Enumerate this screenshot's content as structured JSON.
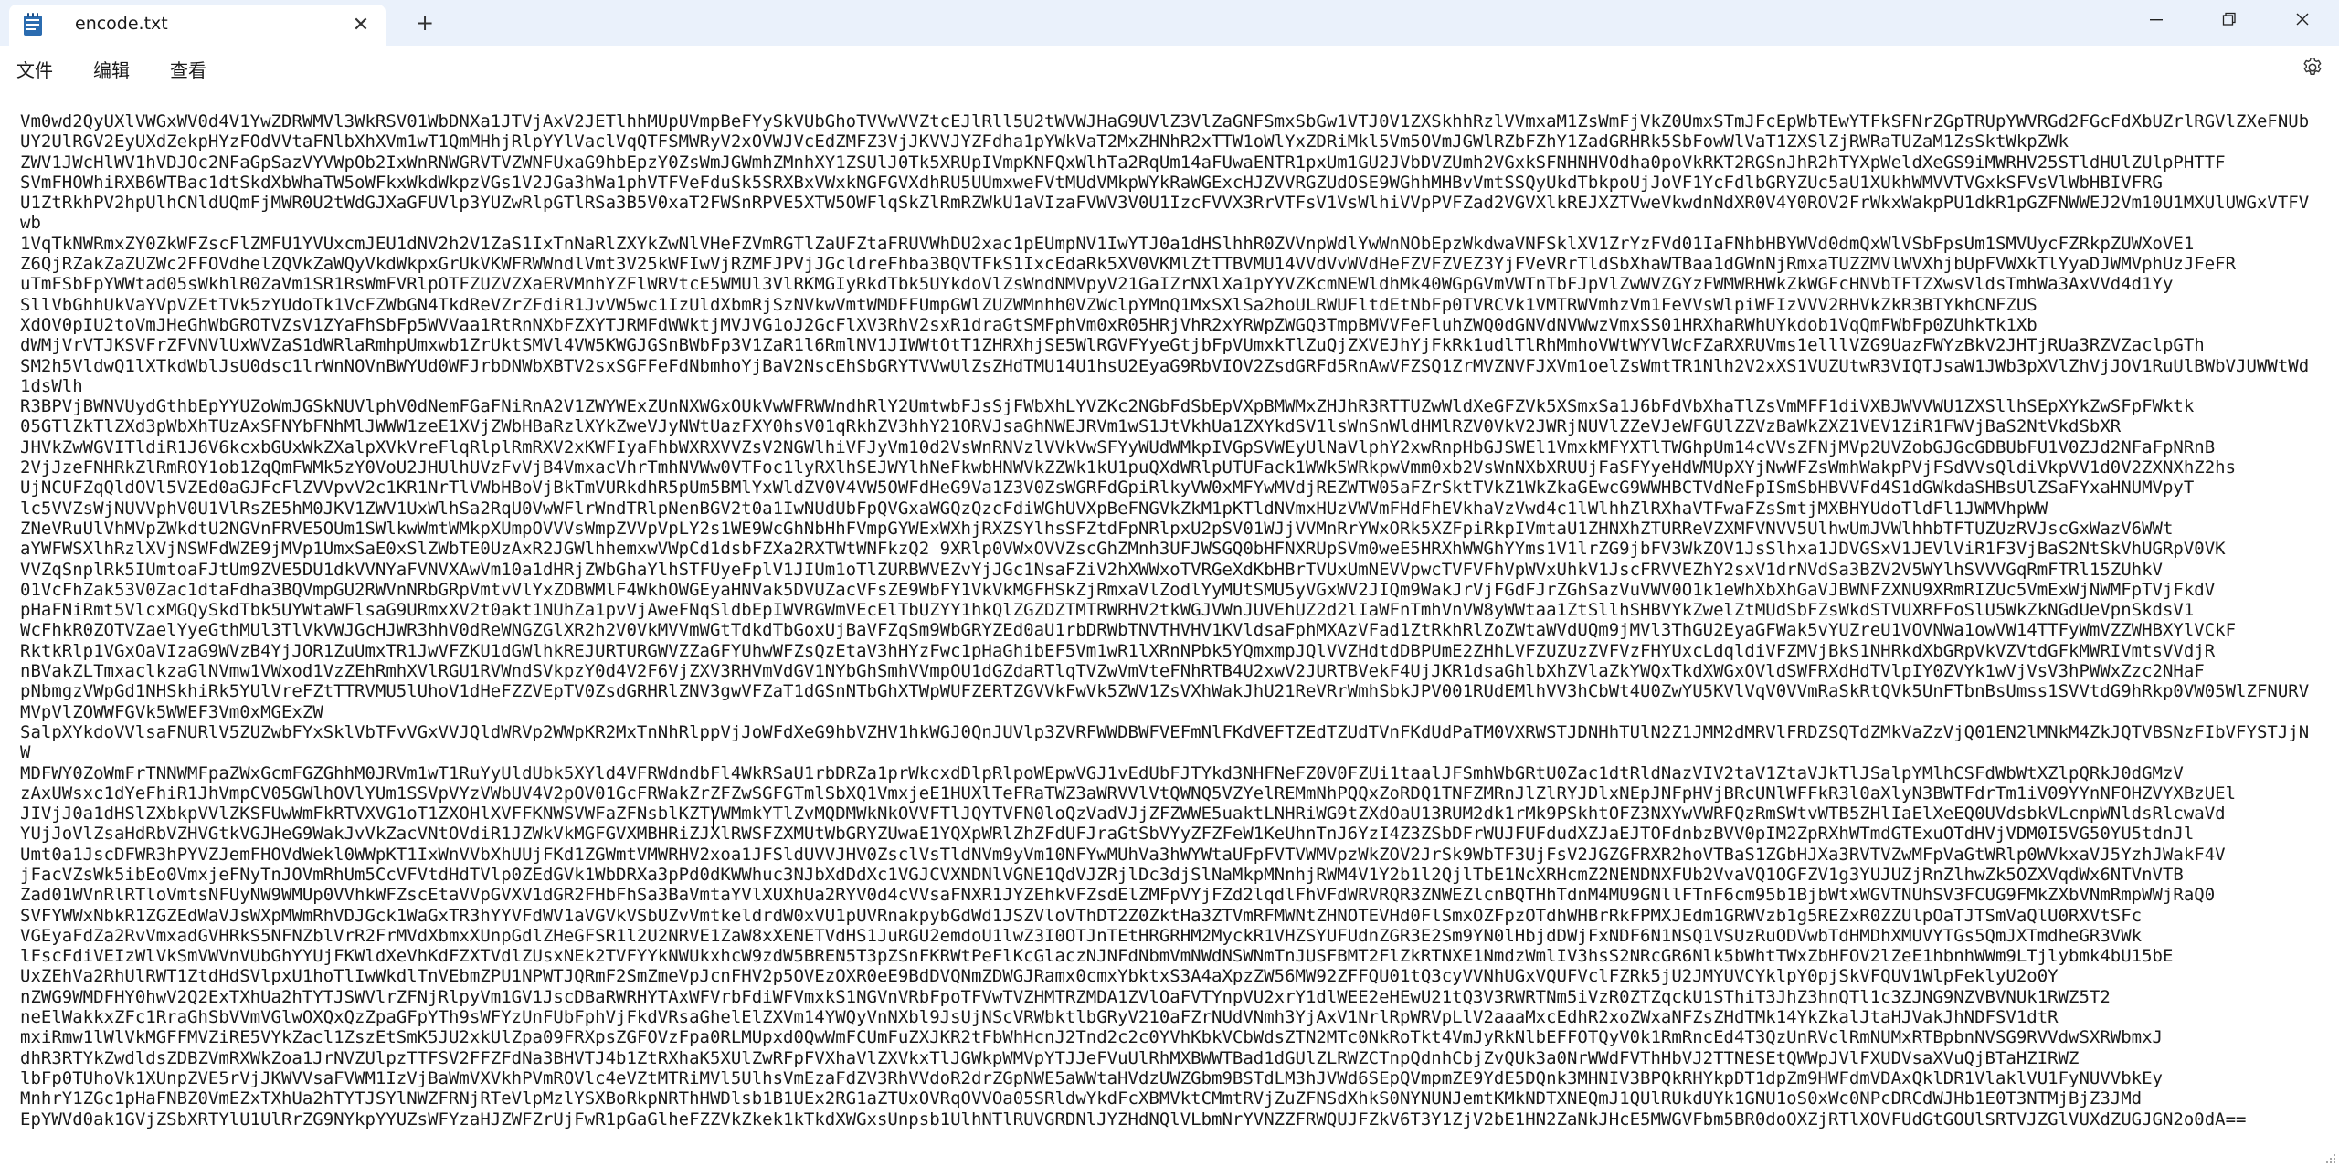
{
  "window": {
    "tab_title": "encode.txt",
    "tab_close_glyph": "✕",
    "new_tab_glyph": "+",
    "icons": {
      "app": "notepad-icon",
      "minimize": "minimize-icon",
      "maximize": "maximize-icon",
      "close": "close-icon",
      "settings": "gear-icon"
    }
  },
  "menu": {
    "file": "文件",
    "edit": "编辑",
    "view": "查看"
  },
  "colors": {
    "titlebar": "#eaf1fb",
    "tab": "#ffffff",
    "text": "#1a1a1a",
    "icon_blue": "#2b6cb0"
  },
  "editor": {
    "content": "Vm0wd2QyUXlVWGxWV0d4V1YwZDRWMVl3WkRSV01WbDNXa1JTVjAxV2JETlhhMUpUVmpBeFYySkVUbGhoTVVwVVZtcEJlRll5U2tWVWJHaG9UVlZ3VlZaGNFSmxSbGw1VTJ0V1ZXSkhhRzlVVmxaM1ZsWmFjVkZ0UmxSTmJFcEpWbTEwYTFkSFNrZGpTRUpYWVRGd2FGcFdXbUZrlRGVlZXeFNUbUY2UlRGV2EyUXdZekpHYzFOdVVtaFNlbXhXVm1wT1QmMHhjRlpYYlVaclVqQTFSMWRyV2xOVWJVcEdZMFZ3VjJKVVJYZFdha1pYWkVaT2MxZHNhR2xTTW1oWlYxZDRiMkl5Vm5OVmJGWlRZbFZhY1ZadGRHRk5SbFowWlVaT1ZXSlZjRWRaTUZaM1ZsSktWkpZWk\nZWV1JWcHlWV1hVDJOc2NFaGpSazVYVWpOb2IxWnRNWGRVTVZWNFUxaG9hbEpzY0ZsWmJGWmhZMnhXY1ZSUlJ0Tk5XRUpIVmpKNFQxWlhTa2RqUm14aFUwaENTR1pxUm1GU2JVbDVZUmh2VGxkSFNHNHVOdha0poVkRKT2RGSnJhR2hTYXpWeldXeGS9iMWRHV25STldHUlZUlpPHTTF\nSVmFHOWhiRXB6WTBac1dtSkdXbWhaTW5oWFkxWkdWkpzVGs1V2JGa3hWa1phVTFVeFduSk5SRXBxVWxkNGFGVXdhRU5UUmxweFVtMUdVMkpWYkRaWGExcHJZVVRGZUdOSE9WGhhMHBvVmtSSQyUkdTbkpoUjJoVF1YcFdlbGRYZUc5aU1XUkhWMVVTVGxkSFVsVlWbHBIVFRG\nU1ZtRkhPV2hpUlhCNldUQmFjMWR0U2tWdGJXaGFUVlp3YUZwRlpGTlRSa3B5V0xaT2FWSnRPVE5XTW5OWFlqSkZlRmRZWkU1aVIzaFVWV3V0U1IzcFVVX3RrVTFsV1VsWlhiVVpPVFZad2VGVXlkREJXZTVweVkwdnNdXR0V4Y0ROV2FrWkxWakpPU1dkR1pGZFNWWEJ2Vm10U1MXUlUWGxVTFVwb\n1VqTkNWRmxZY0ZkWFZscFlZMFU1YVUxcmJEU1dNV2h2V1ZaS1IxTnNaRlZXYkZwNlVHeFZVmRGTlZaUFZtaFRUVWhDU2xac1pEUmpNV1IwYTJ0a1dHSlhhR0ZVVnpWdlYwWnNObEpzWkdwaVNFSklXV1ZrYzFVd01IaFNhbHBYWVd0dmQxWlVSbFpsUm1SMVUycFZRkpZUWXoVE1\nZ6QjRZakZaZUZWc2FFOVdhelZQVkZaWQyVkdWkpxGrUkVKWFRWWndlVmt3V25kWFIwVjRZMFJPVjJGcldreFhba3BQVTFkS1IxcEdaRk5XV0VKMlZtTTBVMU14VVdVvWVdHeFZVFZVEZ3YjFVeVRrTldSbXhaWTBaa1dGWnNjRmxaTUZZMVlWVXhjbUpFVWXkTlYyaDJWMVphUzJFeFR\nuTmFSbFpYWWtad05sWkhlR0ZaVm1SR1RsWmFVRlpOTFZUZVZXaERVMnhYZFlWRVtcE5WMUl3VlRKMGIyRkdTbk5UYkdoVlZsWndNMVpyV21GaIZrNXlXa1pYYVZKcmNEWldhMk40WGpGVmVWTnTbFJpVlZwWVZGYzFWMWRHWkZkWGFcHNVbTFTZXwsVldsTmhWa3AxVVd4d1Yy\nSllVbGhhUkVaYVpVZEtTVk5zYUdoTk1VcFZWbGN4TkdReVZrZFdiR1JvVW5wc1IzUldXbmRjSzNVkwVmtWMDFFUmpGWlZUZWMnhh0VZWclpYMnQ1MxSXlSa2hoULRWUFltdEtNbFp0TVRCVk1VMTRWVmhzVm1FeVVsWlpiWFIzVVV2RHVkZkR3BTYkhCNFZUS\nXdOV0pIU2toVmJHeGhWbGROTVZsV1ZYaFhSbFp5WVVaa1RtRnNXbFZXYTJRMFdWWktjMVJVG1oJ2GcFlXV3RhV2sxR1draGtSMFphVm0xR05HRjVhR2xYRWpZWGQ3TmpBMVVFeFluhZWQ0dGNVdNVWwzVmxSS01HRXhaRWhUYkdob1VqQmFWbFp0ZUhkTk1Xb\ndWMjVrVTJKSVFrZFVNVlUxWVZaS1dWRlaRmhpUmxwb1ZrUktSMVl4VW5KWGJGSnBWbFp3V1ZaR1l6RmlNV1JIWWtOtT1ZHRXhjSE5WlRGVFYyeGtjbFpVUmxkTlZuQjZXVEJhYjFkRk1udlTlRhMmhoVWtWYVlWcFZaRXRUVms1elllVZG9UazFWYzBkV2JHTjRUa3RZVZaclpGTh\nSM2h5VldwQ1lXTkdWblJsU0dsc1lrWnNOVnBWYUd0WFJrbDNWbXBTV2sxSGFFeFdNbmhoYjBaV2NscEhSbGRYTVVwUlZsZHdTMU14U1hsU2EyaG9RbVIOV2ZsdGRFd5RnAwVFZSQ1ZrMVZNVFJXVm1oelZsWmtTR1Nlh2V2xXS1VUZUtwR3VIQTJsaW1JWb3pXVlZhVjJOV1RuUlBWbVJUWWtWd1dsWlh\nR3BPVjBWNVUydGthbEpYYUZoWmJGSkNUVlphV0dNemFGaFNiRnA2V1ZWYWExZUnNXWGxOUkVwWFRWWndhRlY2UmtwbFJsSjFWbXhLYVZKc2NGbFdSbEpVXpBMWMxZHJhR3RTTUZwWldXeGFZVk5XSmxSa1J6bFdVbXhaTlZsVmMFF1diVXBJWVVWU1ZXSllhSEpXYkZwSFpFWktk\n05GTlZkTlZXd3pWbXhTUzAxSFNYbFNhMlJWWW1zeE1XVjZWbHBaRzlXYkZweVJyNWtUazFXY0hsV01qRkhZV3hhY21ORVJsaGhNWEJRVm1wS1JtVkhUa1ZXYkdSV1lsWnSnWldHMlRZV0VkV2JWRjNUVlZZeVJeWFGUlZZVzBaWkZXZ1VEV1ZiR1FWVjBaS2NtVkdSbXR\nJHVkZwWGVITldiR1J6V6kcxbGUxWkZXalpXVkVreFlqRlplRmRXV2xKWFIyaFhbWXRXVVZsV2NGWlhiVFJyVm10d2VsWnRNVzlVVkVwSFYyWUdWMkpIVGpSVWEyUlNaVlphY2xwRnpHbGJSWEl1VmxkMFYXTlTWGhpUm14cVVsZFNjMVp2UVZobGJGcGDBUbFU1V0ZJd2NFaFpNRnB\n2VjJzeFNHRkZlRmROY1ob1ZqQmFWMk5zY0VoU2JHUlhUVzFvVjB4VmxacVhrTmhNVWw0VTFoc1lyRXlhSEJWYlhNeFkwbHNWVkZZWk1kU1puQXdWRlpUTUFack1WWk5WRkpwVmm0xb2VsWnNXbXRUUjFaSFYyeHdWMUpXYjNwWFZsWmhWakpPVjFSdVVsQldiVkpVV1d0V2ZXNXhZ2hs\nUjNCUFZqQldOVl5VZEd0aGJFcFlZVVpvV2c1KR1NrTlVWbHBoVjBkTmVURkdhR5pUm5BMlYxWldZV0V4VW5OWFdHeG9Va1Z3V0ZsWGRFdGpiRlkyVW0xMFYwMVdjREZWTW05aFZrSktTVkZ1WkZkaGEwcG9WWHBCTVdNeFpISmSbHBVVFd4S1dGWkdaSHBsUlZSaFYxaHNUMVpyT\nlc5VVZsWjNUVVphV0U1VlRsZE5hM0JKV1ZWV1UxWlhSa2RqU0VwWFlrWndTRlpNenBGV2t0a1IwNUdUbFpQVGxaWGQzQzcFdiWGhUVXpBeFNGVkZkM1pKTldNVmxHUzVWVmFHdFhEVkhaVzVwd4c1lWlhhZlRXhaVTFwaFZsSmtjMXBHYUdoTldFl1JWMVhpWW\nZNeVRuUlVhMVpZWkdtU2NGVnFRVE5OUm1SWlkwWmtWMkpXUmpOVVVsWmpZVVpVpLY2s1WE9WcGhNbHhFVmpGYWExWXhjRXZSYlhsSFZtdFpNRlpxU2pSV01WJjVVMnRrYWxORk5XZFpiRkpIVmtaU1ZHNXhZTURReVZXMFVNVV5UlhwUmJVWlhhbTFTUZUzRVJscGxWazV6WWt\naYWFWSXlhRzlXVjNSWFdWZE9jMVp1UmxSaE0xSlZWbTE0UzAxR2JGWlhhemxwVWpCd1dsbFZXa2RXTWtWNFkzQ2 9XRlp0VWxOVVZscGhZMnh3UFJWSGQ0bHFNXRUpSVm0weE5HRXhWWGhYYms1V1lrZG9jbFV3WkZOV1JsSlhxa1JDVGSxV1JEVlViR1F3VjBaS2NtSkVhUGRpV0VK\nVVZqSnplRk5IUmtoaFJtUm9ZVE5DU1dkVVNYaFVNVXAwVm10a1dHRjZWbGhaYlhSTFUyeFplV1JIUm1oTlZURBWVEZvYjJGc1NsaFZiV2hXWWxoTVRGeXdKbHBrTVUxUmNEVVpwcTVFVFhVpWVxUhkV1JscFRVVEZhY2sxV1drNVdSa3BZV2V5WYlhSVVVGqRmFTRl15ZUhkV\n01VcFhZak53V0Zac1dtaFdha3BQVmpGU2RWVnNRbGRpVmtvVlYxZDBWMlF4WkhOWGEyaHNVak5DVUZacVFsZE9WbFY1VkVkMGFHSkZjRmxaVlZodlYyMUtSMU5yVGxWV2JIQm9WakJrVjFGdFJrZGhSazVuVWV0O1k1eWhXbXhGaVJBWNFZXNU9XRmRIZUc5VmExWjNWMFpTVjFkdV\npHaFNiRmt5VlcxMGQySkdTbk5UYWtaWFlsaG9URmxXV2t0akt1NUhZa1pvVjAweFNqSldbEpIWVRGWmVEcElTbUZYY1hkQlZGZDZTMTRWRHV2tkWGJVWnJUVEhUZ2d2lIaWFnTmhVnVW8yWWtaa1ZtSllhSHBVYkZwelZtMUdSbFZsWkdSTVUXRFFoSlU5WkZkNGdUeVpnSkdsV1\nWcFhkR0ZOTVZaelYyeGthMUl3TlVkVWJGcHJWR3hhV0dReWNGZGlXR2h2V0VkMVVmWGtTdkdTbGoxUjBaVFZqSm9WbGRYZEd0aU1rbDRWbTNVTHVHV1KVldsaFphMXAzVFad1ZtRkhRlZoZWtaWVdUQm9jMVl3ThGU2EyaGFWak5vYUZreU1VOVNWa1owVW14TTFyWmVZZWHBXYlVCkF\nRktkRlp1VGxOaVIzaG9WVzB4YjJOR1ZuUmxTR1JwVFZKU1dGWlhkREJURTURGWVZZaGFYUhwWFZsQzEtaV3hHYzFwc1pHaGhibEF5Vm1wR1lXRnNPbk5YQmxmpJQlVVZHdtdDBPUmE2ZHhLVFZUZUzZVFVzFHYUxcLdqldiVFZMVjBkS1NHRkdXbGRpVkVZVtdGFkMWRIVmtsVVdjR\nnBVakZLTmxaclkzaGlNVmw1VWxod1VzZEhRmhXVlRGU1RVWndSVkpzY0d4V2F6VjZXV3RHVmVdGV1NYbGhSmhVVmpOU1dGZdaRTlqTVZwVmVteFNhRTB4U2xwV2JURTBVekF4UjJKR1dsaGhlbXhZVlaZkYWQxTkdXWGxOVldSWFRXdHdTVlpIY0ZVYk1wVjVsV3hPWWxZzc2NHaF\npNbmgzVWpGd1NHSkhiRk5YUlVreFZtTTRVMU5lUhoV1dHeFZZVEpTV0ZsdGRHRlZNV3gwVFZaT1dGSnNTbGhXTWpWUFZERTZGVVkFwVk5ZWV1ZsVXhWakJhU21ReVRrWmhSbkJPV001RUdEMlhVV3hCbWt4U0ZwYU5KVlVqV0VVmRaSkRtQVk5UnFTbnBsUmss1SVVtdG9hRkp0VW05WlZFNURVMVpVlZOWWFGVk5WWEF3Vm0xMGExZW\nSalpXYkdoVVlsaFNURlV5ZUZwbFYxSklVbTFvVGxVVJQldWRVp2WWpKR2MxTnNhRlppVjJoWFdXeG9hbVZHV1hkWGJ0QnJUVlp3ZVRFWWDBWFVEFmNlFKdVEFTZEdTZUdTVnFKdUdPaTM0VXRWSTJDNHhTUlN2Z1JMM2dMRVlFRDZSQTdZMkVaZzVjQ01EN2lMNkM4ZkJQTVBSNzFIbVFYSTJjNW\nMDFWY0ZoWmFrTNNWMFpaZWxGcmFGZGhhM0JRVm1wT1RuYyUldUbk5XYld4VFRWdndbFl4WkRSaU1rbDRZa1prWkcxdDlpRlpoWEpwVGJ1vEdUbFJTYkd3NHFNeFZ0V0FZUi1taalJFSmhWbGRtU0Zac1dtRldNazVIV2taV1ZtaVJkTlJSalpYMlhCSFdWbWtXZlpQRkJ0dGMzV\nzAxUWsxc1dYeFhiR1JhVmpCV05GWlhOVlYUm1SSVpVYzVWbUV4V2pOV01GcFRWakZrZFZwSGFGTmlSbXQ1VmxjeE1HUXlTeFRaTWZ3aWRVVlVtQWNQ5VZYelREMmNhPQQxZoRDQ1TNFZMRnJlZlRYJDlxNEpJNFpHVjBRcUNlWFFkR3l0aXlyN3BWTFdrTm1iV09YYnNFOHZVYXBzUEl\nJIVjJ0a1dHSlZXbkpVVlZKSFUwWmFkRTVXVG1oT1ZXOHlXVFFKNWSVWFaZFNsblKZTVWMmkYTlZvMQDMWkNkOVVFTlJQYTVFN0loQzVadVJjZFZWWE5uaktLNHRiWG9tZXdOaU13RUM2dk1rMk9PSkhtOFZ3NXYwVWRFQzRmSWtvWTB5ZHlIaElXeEQ0UVdsbkVLcnpWNldsRlcwaVd\nYUjJoVlZsaHdRbVZHVGtkVGJHeG9WakJvVkZacVNtOVdiR1JZWkVkMGFGVXMBHRiZJXlRWSFZXMUtWbGRYZUwaE1YQXpWRlZhZFdUFJraGtSbVYyZFZFeW1KeUhnTnJ6YzI4Z3ZSbDFrWUJFUFdudXZJaEJTOFdnbzBVV0pIM2ZpRXhWTmdGTExuOTdHVjVDM0I5VG50YU5tdnJl\nUmt0a1JscDFWR3hPYVZJemFHOVdWekl0WWpKT1IxWnVVbXhUUjFKd1ZGWmtVMWRHV2xoa1JFSldUVVJHV0ZsclVsTldNVm9yVm10NFYwMUhVa3hWYWtaUFpFVTVWMVpzWkZOV2JrSk9WbTF3UjFsV2JGZGFRXR2hoVTBaS1ZGbHJXa3RVTVZwMFpVaGtWRlp0WVkxaVJ5YzhJWakF4V\njFacVZsWk5ibEo0VmxjeFNyTnJOVmRhUm5CcVFVtdHdTVlp0ZEdGVk1WbDRXa3pPd0dKWWhuc3NJbXdDdXc1VGJCVXNDNlVGNE1QdVJZRjlDc3djSlNaMkpMNnhjRWM4V1Y2b1l2QjlTbE1NcXRHcmZ2NENDNXFUb2VvaVQ1OGFZV1g3YUJUZjRnZlhwZk5OZXVqdWx6NTVnVTB\nZad01WVnRlRTloVmtsNFUyNW9WMUp0VVhkWFZscEtaVVpGVXV1dGR2FHbFhSa3BaVmtaYVlXUXhUa2RYV0d4cVVsaFNXR1JYZEhkVFZsdElZMFpVYjFZd2lqdlFhVFdWRVRQR3ZNWEZlcnBQTHhTdnM4MU9GNllFTnF6cm95b1BjbWtxWGVTNUhSV3FCUG9FMkZXbVNmRmpWWjRaQ0\nSVFYWWxNbkR1ZGZEdWaVJsWXpMWmRhVDJGck1WaGxTR3hYYVFdWV1aVGVkVSbUZvVmtkeldrdW0xVU1pUVRnakpybGdWd1JSZVloVThDT2Z0ZktHa3ZTVmRFMWNtZHNOTEVHd0FlSmxOZFpzOTdhWHBrRkFPMXJEdm1GRWVzb1g5REZxR0ZZUlpOaTJTSmVaQlU0RXVtSFc\nVGEyaFdZa2RvVmxadGVHRkS5NFNZblVrR2FrMVdXbmxXUnpGdlZHeGFSR1l2U2NRVE1ZaW8xXENETVdHS1JuRGU2emdoU1lwZ3I0OTJnTEtHRGRHM2MyckR1VHZSYUFUdnZGR3E2Sm9YN0lHbjdDWjFxNDF6N1NSQ1VSUzRuODVwbTdHMDhXMUVYTGs5QmJXTmdheGR3VWk\nlFscFdiVEIzWlVkSmVWVnVUbGhYYUjFKWldXeVhKdFZXTVdlZUsxNEk2TVFYYkNWUkxhcW9zdW5BREN5T3pZSnFKRWtPeFlKcGlaczNJNFdNbmVmNWdNSWNmTnJUSFBMT2FlZkRTNXE1NmdzWmlIV3hsS2NRcGR6Nlk5bWhtTWxZbHFOV2lZeE1hbnhWWm9LTjlybmk4bU15bE\nUxZEhVa2RhUlRWT1ZtdHdSVlpxU1hoTlIwWkdlTnVEbmZPU1NPWTJQRmF2SmZmeVpJcnFHV2p5OVEzOXR0eE9BdDVQNmZDWGJRamx0cmxYbktxS3A4aXpzZW56MW92ZFFQU01tQ3cyVVNhUGxVQUFVclFZRk5jU2JMYUVCYklpY0pjSkVFQUV1WlpFeklyU2o0Y\nnZWG9WMDFHY0hwV2Q2ExTXhUa2hTYTJSWVlrZFNjRlpyVm1GV1JscDBaRWRHYTAxWFVrbFdiWFVmxkS1NGVnVRbFpoTFVwTVZHMTRZMDA1ZVlOaFVTYnpVU2xrY1dlWEE2eHEwU21tQ3V3RWRTNm5iVzR0ZTZqckU1SThiT3JhZ3hnQTl1c3ZJNG9NZVBVNUk1RWZ5T2\nneElWakkxZFc1RraGhSbVVmVGlwOXQxQzZpaGFpYTh9sWFYzUnFUbFphVjFkdVRsaGhelElZXVm14YWQyVnNXbl9JsUjNScVRWbktlbGRyV210aFZrNUdVNmh3YjAxV1NrlRpWRVpLlV2aaaMxcEdhR2xoZWxaNFZsZHdTMk14YkZkalJtaHJVakJhNDFSV1dtR\nmxiRmw1lWlVkMGFFMVZiRE5VYkZacl1ZszEtSmK5JU2xkUlZpa09FRXpsZGFOVzFpa0RLMUpxd0QwWmFCUmFuZXJKR2tFbWhHcnJ2Tnd2c2c0YVhKbkVCbWdsZTN2MTc0NkRoTkt4VmJyRkNlbEFFOTQyV0k1RmRncEd4T3QzUnRVclRmNUMxRTBpbnNVSG9RVVdwSXRWbmxJ\ndhR3RTYkZwdldsZDBZVmRXWkZoa1JrNVZUlpzTTFSV2FFZFdNa3BHVTJ4b1ZtRXhaK5XUlZwRFpFVXhaVlZXVkxTlJGWkpWMVpYTJJeFVuUlRhMXBWWTBad1dGUlZLRWZCTnpQdnhCbjZvQUk3a0NrWWdFVThHbVJ2TTNESEtQWWpJVlFXUDVsaXVuQjBTaHZIRWZ\nlbFp0TUhoVk1XUnpZVE5rVjJKWVVsaFVWM1IzVjBaWmVXVkhPVmROVlc4eVZtMTRiMVl5UlhsVmEzaFdZV3RhVVdoR2drZGpNWE5aWWtaHVdzUWZGbm9BSTdLM3hJVWd6SEpQVmpmZE9YdE5DQnk3MHNIV3BPQkRHYkpDT1dpZm9HWFdmVDAxQklDR1VlaklVU1FyNUVVbkEy\nMnhrY1ZGc1pHaFNBZ0VmEZxTXhUa2hTYTJSYlNWZFRNjRTeVlpMzlYSXBoRkpNRThHWDlsb1B1UEx2RG1aZTUxOVRqOVVOa05SRldwYkdFcXBMVktCMmtRVjZuZFNSdXhkS0NYNUNJemtKMkNDTXNEQmJ1QUlRUkdUYk1GNU1oS0xWc0NPcDRCdWJHb1E0T3NTMjBjZ3JMd\nEpYWVd0ak1GVjZSbXRTYlU1UlRrZG9NYkpYYUZsWFYzaHJZWFZrUjFwR1pGaGlheFZZVkZkek1kTkdXWGxsUnpsb1UlhNTlRUVGRDNlJYZHdNQlVLbmNrYVNZZFRWQUJFZkV6T3Y1ZjV2bE1HN2ZaNkJHcE5MWGVFbm5BR0doOXZjRTlXOVFUdGtGOUlSRTVJZGlVUXdZUGJGN2o0dA=="
  }
}
